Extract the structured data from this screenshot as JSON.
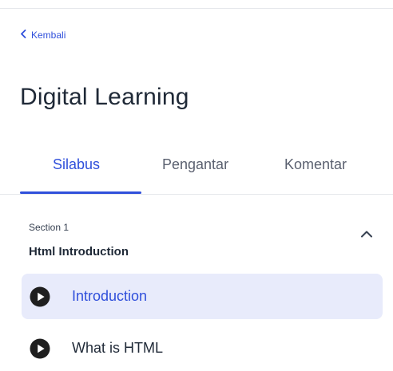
{
  "nav": {
    "back_label": "Kembali"
  },
  "page": {
    "title": "Digital Learning"
  },
  "tabs": [
    {
      "label": "Silabus",
      "active": true
    },
    {
      "label": "Pengantar",
      "active": false
    },
    {
      "label": "Komentar",
      "active": false
    }
  ],
  "section": {
    "eyebrow": "Section 1",
    "title": "Html Introduction",
    "expanded": true,
    "lessons": [
      {
        "label": "Introduction",
        "active": true,
        "icon": "play-circle-icon"
      },
      {
        "label": "What is HTML",
        "active": false,
        "icon": "play-circle-icon"
      }
    ]
  },
  "colors": {
    "accent": "#2f4fdb",
    "active_row_bg": "#e8ebfb",
    "text": "#1f2937",
    "muted": "#5b6170",
    "divider": "#e5e7eb"
  }
}
